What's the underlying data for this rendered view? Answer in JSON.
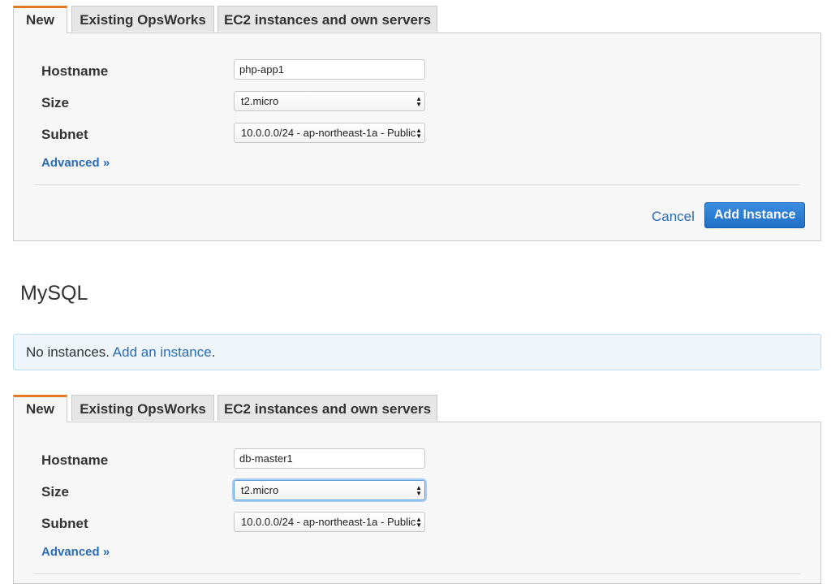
{
  "forms": [
    {
      "tabs": [
        "New",
        "Existing OpsWorks",
        "EC2 instances and own servers"
      ],
      "hostname_label": "Hostname",
      "hostname_value": "php-app1",
      "size_label": "Size",
      "size_value": "t2.micro",
      "subnet_label": "Subnet",
      "subnet_value": "10.0.0.0/24 - ap-northeast-1a - Public",
      "advanced_link": "Advanced »",
      "cancel_label": "Cancel",
      "add_label": "Add Instance"
    },
    {
      "tabs": [
        "New",
        "Existing OpsWorks",
        "EC2 instances and own servers"
      ],
      "hostname_label": "Hostname",
      "hostname_value": "db-master1",
      "size_label": "Size",
      "size_value": "t2.micro",
      "subnet_label": "Subnet",
      "subnet_value": "10.0.0.0/24 - ap-northeast-1a - Public",
      "advanced_link": "Advanced »"
    }
  ],
  "mysql_section": {
    "heading": "MySQL",
    "alert_text": "No instances.",
    "alert_link": "Add an instance",
    "alert_end": "."
  }
}
